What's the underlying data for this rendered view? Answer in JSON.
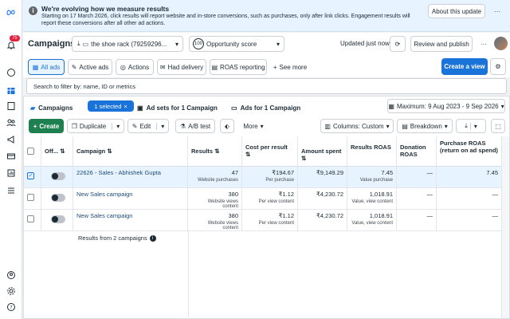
{
  "banner": {
    "title": "We're evolving how we measure results",
    "body": "Starting on 17 March 2026, click results will report website and in-store conversions, such as purchases, only after link clicks. Engagement results will report these conversions after all other ad actions.",
    "about_label": "About this update",
    "more_label": "···"
  },
  "rail": {
    "notification_count": "75"
  },
  "header": {
    "title": "Campaigns",
    "account": "the shoe rack (79259296...",
    "score_value": "100",
    "score_label": "Opportunity score",
    "updated": "Updated just now",
    "review_label": "Review and publish"
  },
  "tabs": {
    "items": [
      {
        "label": "All ads"
      },
      {
        "label": "Active ads"
      },
      {
        "label": "Actions"
      },
      {
        "label": "Had delivery"
      },
      {
        "label": "ROAS reporting"
      }
    ],
    "see_more": "See more",
    "create_view": "Create a view"
  },
  "filter": {
    "placeholder": "Search to filter by: name, ID or metrics"
  },
  "levels": {
    "campaigns": "Campaigns",
    "selected": "1 selected",
    "adsets": "Ad sets for 1 Campaign",
    "ads": "Ads for 1 Campaign",
    "date_range": "Maximum: 9 Aug 2023 - 9 Sep 2026"
  },
  "toolbar": {
    "create": "Create",
    "duplicate": "Duplicate",
    "edit": "Edit",
    "ab_test": "A/B test",
    "more": "More",
    "columns": "Columns: Custom",
    "breakdown": "Breakdown"
  },
  "table": {
    "headers": {
      "off_on": "Off...",
      "campaign": "Campaign",
      "results": "Results",
      "cost": "Cost per result",
      "amount": "Amount spent",
      "results_roas": "Results ROAS",
      "donation_roas": "Donation ROAS",
      "purchase_roas": "Purchase ROAS (return on ad spend)"
    },
    "rows": [
      {
        "name": "22626 - Sales - Abhishek Gupta",
        "results": "47",
        "results_sub": "Website purchases",
        "cost": "₹194.67",
        "cost_sub": "Per purchase",
        "amount": "₹9,149.29",
        "roas": "7.45",
        "roas_sub": "Value purchase",
        "donation": "—",
        "purchase": "7.45"
      },
      {
        "name": "New Sales campaign",
        "results": "380",
        "results_sub": "Website views content",
        "cost": "₹1.12",
        "cost_sub": "Per view content",
        "amount": "₹4,230.72",
        "roas": "1,018.91",
        "roas_sub": "Value, view content",
        "donation": "—",
        "purchase": "—"
      },
      {
        "name": "New Sales campaign",
        "results": "380",
        "results_sub": "Website views content",
        "cost": "₹1.12",
        "cost_sub": "Per view content",
        "amount": "₹4,230.72",
        "roas": "1,018.91",
        "roas_sub": "Value, view content",
        "donation": "—",
        "purchase": "—"
      }
    ],
    "footer": "Results from 2 campaigns"
  }
}
